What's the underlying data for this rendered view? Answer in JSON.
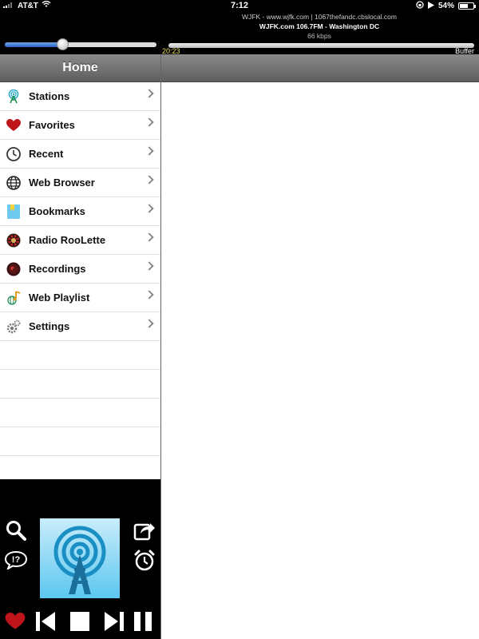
{
  "status_bar": {
    "carrier": "AT&T",
    "time": "7:12",
    "battery": "54%"
  },
  "now_playing": {
    "title": "WJFK - www.wjfk.com | 1067thefandc.cbslocal.com",
    "station": "WJFK.com 106.7FM - Washington DC",
    "bitrate": "66 kbps",
    "elapsed": "20:23",
    "buffer_label": "Buffer",
    "volume": 0.38
  },
  "nav": {
    "title": "Home"
  },
  "menu": [
    {
      "label": "Stations",
      "icon": "stations-icon"
    },
    {
      "label": "Favorites",
      "icon": "heart-icon"
    },
    {
      "label": "Recent",
      "icon": "clock-icon"
    },
    {
      "label": "Web Browser",
      "icon": "globe-icon"
    },
    {
      "label": "Bookmarks",
      "icon": "bookmark-icon"
    },
    {
      "label": "Radio RooLette",
      "icon": "roulette-icon"
    },
    {
      "label": "Recordings",
      "icon": "record-icon"
    },
    {
      "label": "Web Playlist",
      "icon": "playlist-icon"
    },
    {
      "label": "Settings",
      "icon": "gear-icon"
    }
  ],
  "colors": {
    "accent_blue": "#2b63c6",
    "heart_red": "#c0141b",
    "elapsed_yellow": "#e8e05a"
  }
}
